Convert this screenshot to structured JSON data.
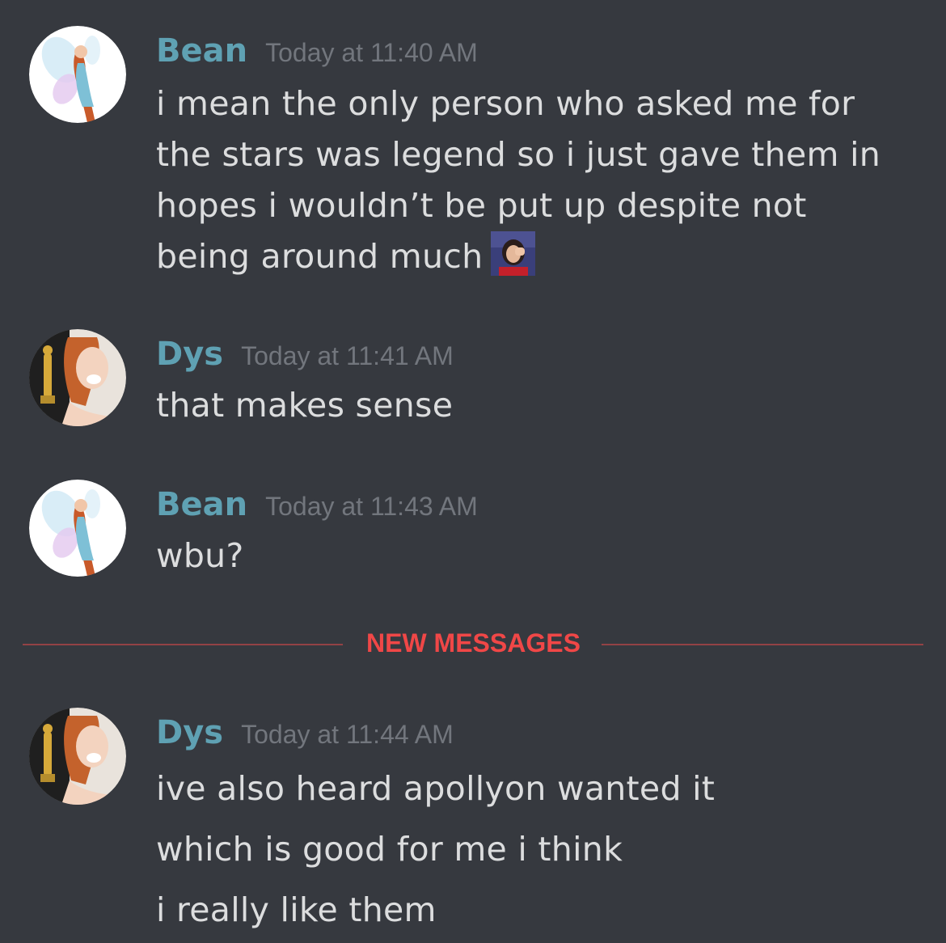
{
  "messages": [
    {
      "author": "Bean",
      "timestamp": "Today at 11:40 AM",
      "avatar": "fairy-avatar",
      "lines": [
        "i mean the only person who asked me for the stars was legend so i just gave them in hopes i wouldn’t be put up despite not being around much"
      ],
      "emoji": "facepalm-emoji"
    },
    {
      "author": "Dys",
      "timestamp": "Today at 11:41 AM",
      "avatar": "oscar-avatar",
      "lines": [
        "that makes sense"
      ]
    },
    {
      "author": "Bean",
      "timestamp": "Today at 11:43 AM",
      "avatar": "fairy-avatar",
      "lines": [
        "wbu?"
      ]
    },
    {
      "author": "Dys",
      "timestamp": "Today at 11:44 AM",
      "avatar": "oscar-avatar",
      "lines": [
        "ive also heard apollyon wanted it",
        "which is good for me i think",
        "i really like them"
      ]
    }
  ],
  "divider": {
    "label": "NEW MESSAGES"
  },
  "colors": {
    "background": "#36393f",
    "username": "#5fa1b3",
    "timestamp": "#72767d",
    "text": "#dcddde",
    "new_messages": "#f04747"
  }
}
